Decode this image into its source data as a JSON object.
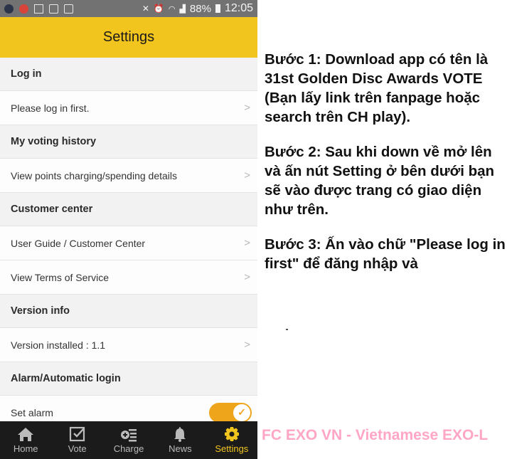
{
  "status_bar": {
    "left_icons": [
      "messenger-icon",
      "youtube-icon",
      "mail-icon",
      "clipboard-icon",
      "briefcase-check-icon"
    ],
    "right_icons": [
      "mute-icon",
      "alarm-icon",
      "wifi-icon",
      "signal-icon"
    ],
    "battery": "88%",
    "time": "12:05"
  },
  "app_bar": {
    "title": "Settings"
  },
  "sections": [
    {
      "header": "Log in",
      "rows": [
        {
          "label": "Please log in first.",
          "chevron": ">"
        }
      ]
    },
    {
      "header": "My voting history",
      "rows": [
        {
          "label": "View points charging/spending details",
          "chevron": ">"
        }
      ]
    },
    {
      "header": "Customer center",
      "rows": [
        {
          "label": "User Guide / Customer Center",
          "chevron": ">"
        },
        {
          "label": "View Terms of Service",
          "chevron": ">"
        }
      ]
    },
    {
      "header": "Version info",
      "rows": [
        {
          "label": "Version installed : 1.1",
          "chevron": ">"
        }
      ]
    },
    {
      "header": "Alarm/Automatic login",
      "rows": [
        {
          "label": "Set alarm",
          "toggle": true,
          "toggle_on": true,
          "toggle_check": "✓"
        }
      ]
    }
  ],
  "tab_bar": {
    "tabs": [
      {
        "label": "Home",
        "icon": "home-icon",
        "active": false
      },
      {
        "label": "Vote",
        "icon": "vote-checkbox-icon",
        "active": false
      },
      {
        "label": "Charge",
        "icon": "charge-add-list-icon",
        "active": false
      },
      {
        "label": "News",
        "icon": "bell-icon",
        "active": false
      },
      {
        "label": "Settings",
        "icon": "gear-icon",
        "active": true
      }
    ],
    "active_color": "#f2c41e"
  },
  "guide": {
    "steps": [
      "Bước 1: Download app có tên là 31st Golden Disc Awards VOTE (Bạn lấy link trên fanpage hoặc search trên CH play).",
      "Bước 2: Sau khi down về mở lên và ấn nút Setting ở bên dưới bạn sẽ vào được trang có giao diện như trên.",
      "Bước 3: Ấn vào chữ \"Please log in first\" để đăng nhập và"
    ]
  },
  "credit": {
    "text": "FC EXO VN - Vietnamese EXO-L",
    "color": "#ffa6c6"
  },
  "colors": {
    "accent": "#f2c41e",
    "toggle": "#eea51c",
    "tabbar_bg": "#1b1b1b",
    "statusbar_bg": "#727272"
  }
}
